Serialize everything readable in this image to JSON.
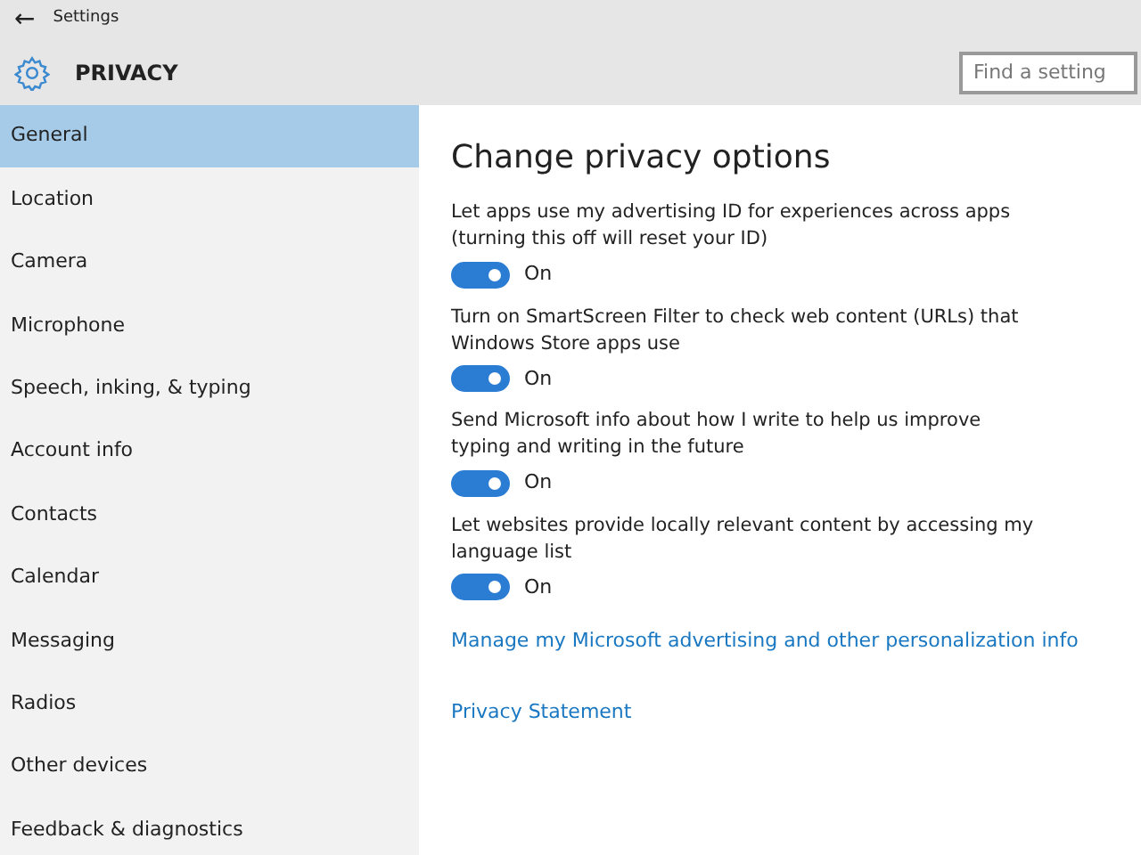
{
  "window": {
    "title": "Settings",
    "back": "←"
  },
  "header": {
    "title": "PRIVACY",
    "search": {
      "placeholder": "Find a setting"
    }
  },
  "sidebar": {
    "items": [
      {
        "label": "General",
        "selected": true
      },
      {
        "label": "Location",
        "selected": false
      },
      {
        "label": "Camera",
        "selected": false
      },
      {
        "label": "Microphone",
        "selected": false
      },
      {
        "label": "Speech, inking, & typing",
        "selected": false
      },
      {
        "label": "Account info",
        "selected": false
      },
      {
        "label": "Contacts",
        "selected": false
      },
      {
        "label": "Calendar",
        "selected": false
      },
      {
        "label": "Messaging",
        "selected": false
      },
      {
        "label": "Radios",
        "selected": false
      },
      {
        "label": "Other devices",
        "selected": false
      },
      {
        "label": "Feedback & diagnostics",
        "selected": false
      }
    ]
  },
  "content": {
    "heading": "Change privacy options",
    "options": [
      {
        "text": "Let apps use my advertising ID for experiences across apps (turning this off will reset your ID)",
        "on": true,
        "state": "On"
      },
      {
        "text": "Turn on SmartScreen Filter to check web content (URLs) that Windows Store apps use",
        "on": true,
        "state": "On"
      },
      {
        "text": "Send Microsoft info about how I write to help us improve typing and writing in the future",
        "on": true,
        "state": "On"
      },
      {
        "text": "Let websites provide locally relevant content by accessing my language list",
        "on": true,
        "state": "On"
      }
    ],
    "links": [
      "Manage my Microsoft advertising and other personalization info",
      "Privacy Statement"
    ]
  }
}
